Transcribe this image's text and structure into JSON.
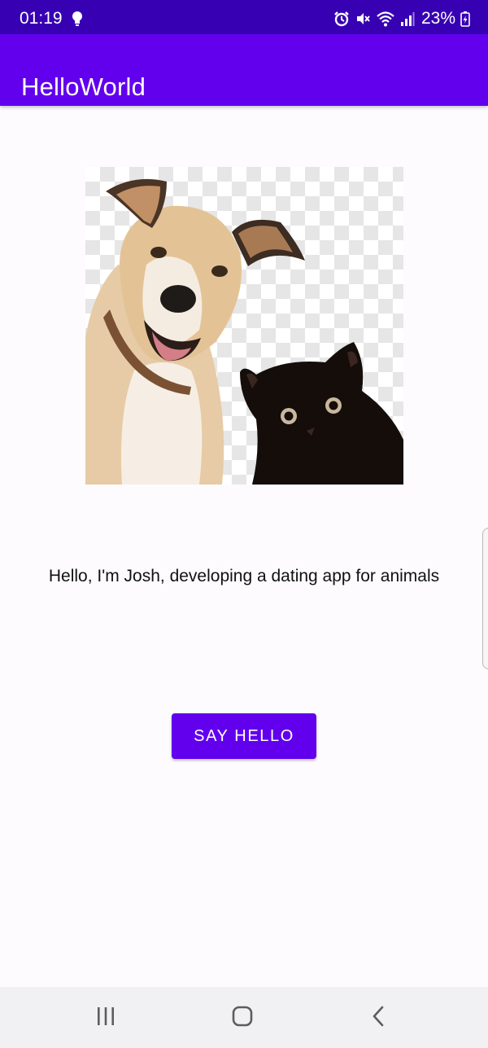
{
  "status_bar": {
    "time": "01:19",
    "battery_percent": "23%",
    "icons": [
      "bulb-icon",
      "alarm-icon",
      "mute-icon",
      "wifi-icon",
      "signal-icon",
      "battery-charging-icon"
    ]
  },
  "app_bar": {
    "title": "HelloWorld"
  },
  "main": {
    "image": {
      "subject": "dog-and-cat-photo"
    },
    "message": "Hello, I'm Josh, developing a dating app for animals",
    "button_label": "SAY HELLO"
  },
  "nav_bar": {
    "buttons": [
      "recents-icon",
      "home-icon",
      "back-icon"
    ]
  },
  "colors": {
    "status_bar": "#3700b3",
    "app_bar": "#6200ee",
    "button": "#6200ee",
    "background": "#fdfbfe",
    "nav_bar": "#f1f0f3"
  }
}
